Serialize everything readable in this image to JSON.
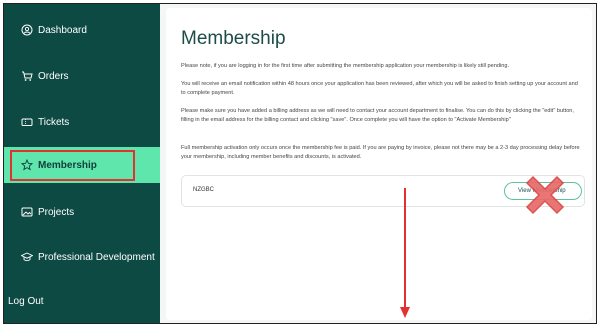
{
  "sidebar": {
    "items": [
      {
        "label": "Dashboard",
        "icon": "user-circle-icon"
      },
      {
        "label": "Orders",
        "icon": "cart-icon"
      },
      {
        "label": "Tickets",
        "icon": "ticket-icon"
      },
      {
        "label": "Membership",
        "icon": "star-icon",
        "active": true
      },
      {
        "label": "Projects",
        "icon": "image-icon"
      },
      {
        "label": "Professional Development",
        "icon": "graduation-cap-icon"
      },
      {
        "label": "Log Out",
        "icon": ""
      }
    ]
  },
  "main": {
    "title": "Membership",
    "paragraphs": [
      "Please note, if you are logging in for the first time after submitting the membership application your membership is likely still pending.",
      "You will receive an email notification within 48 hours once your application has been reviewed, after which you will be asked to finish setting up your account and to complete payment.",
      "Please make sure you have added a billing address as we will need to contact your account department to finalise. You can do this by clicking the \"edit\" button, filling in the email address for the billing contact and clicking \"save\". Once complete you will have the option to \"Activate Membership\"",
      "Full membership activation only occurs once the membership fee is paid. If you are paying by invoice, please not there may be a 2-3 day processing delay before your membership, including member benefits and discounts, is activated."
    ],
    "membership_row": {
      "code": "NZGBC",
      "button_label": "View Membership"
    }
  },
  "colors": {
    "sidebar_bg": "#0d4a44",
    "active_bg": "#5ee6ad",
    "annotation_red": "#e53030"
  }
}
